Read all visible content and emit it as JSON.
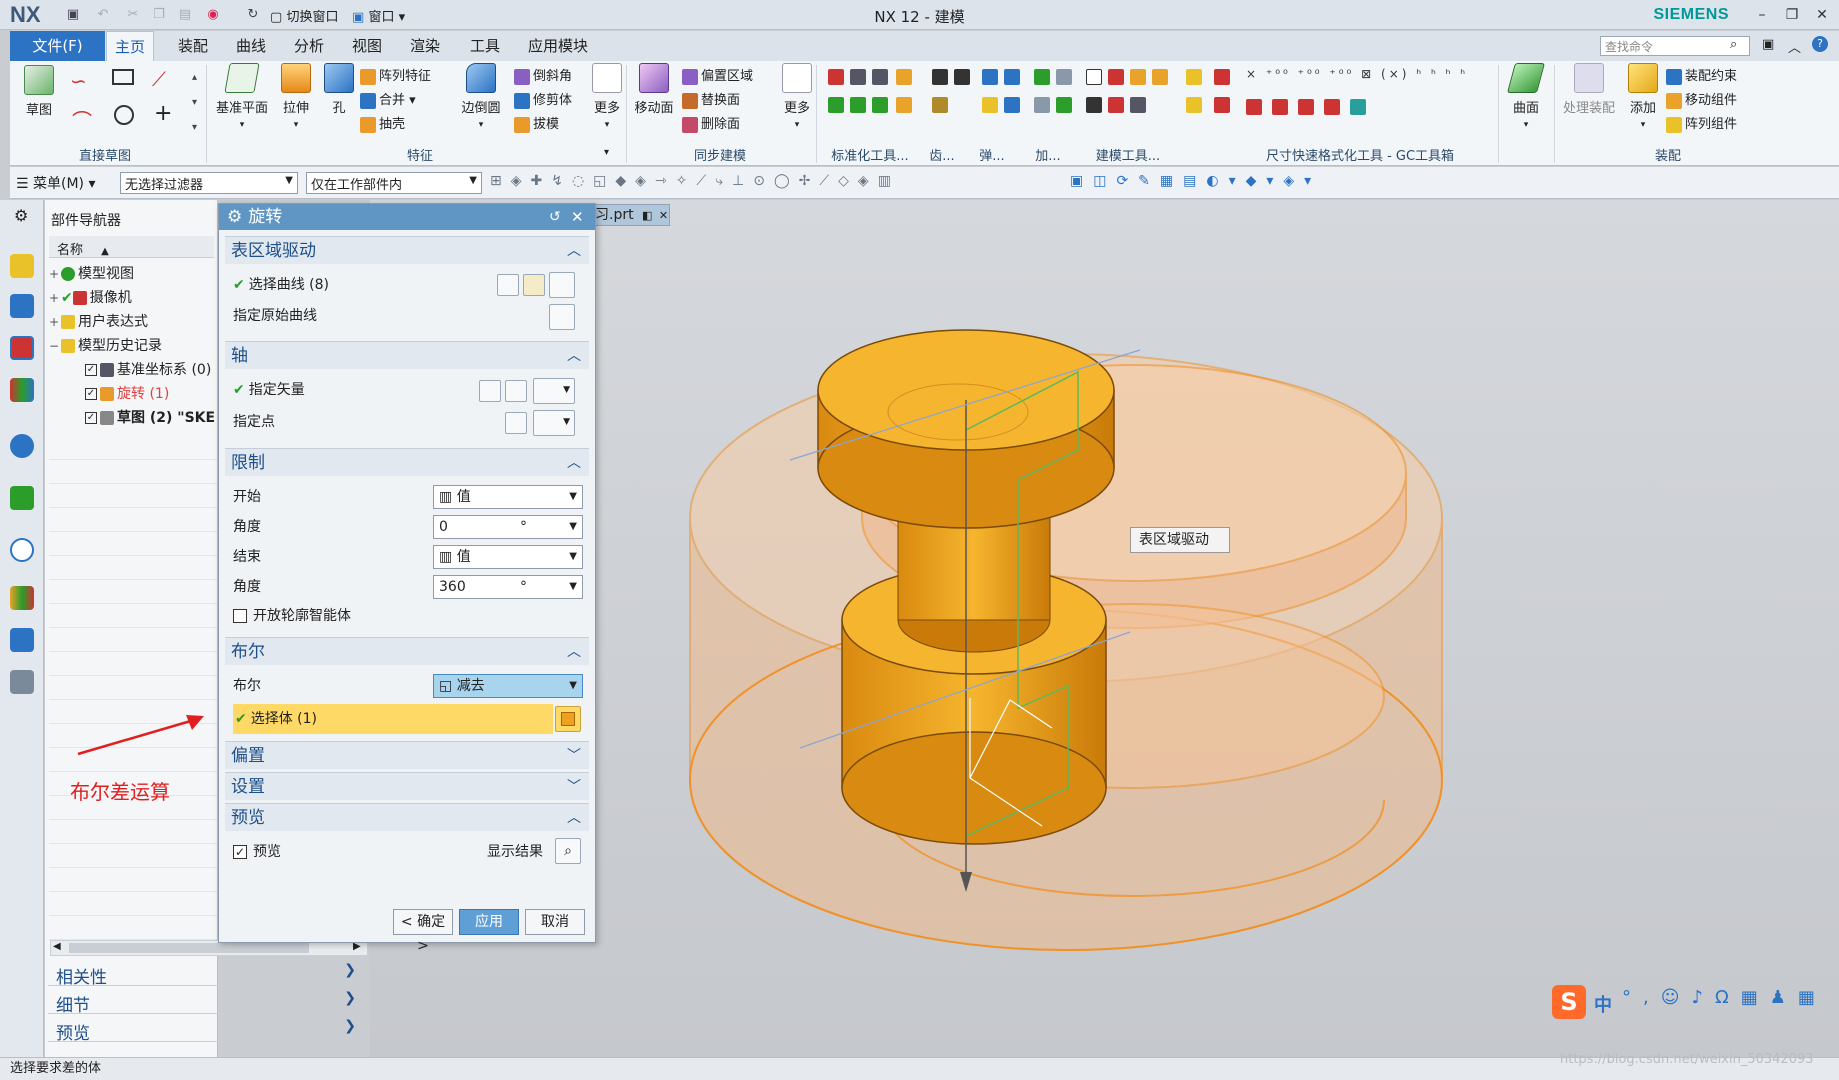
{
  "app": {
    "logo": "NX",
    "window_title": "NX 12 - 建模",
    "brand": "SIEMENS",
    "search_placeholder": "查找命令"
  },
  "menu_tabs": [
    "文件(F)",
    "主页",
    "装配",
    "曲线",
    "分析",
    "视图",
    "渲染",
    "工具",
    "应用模块"
  ],
  "quick_access": {
    "switch_window": "切换窗口",
    "window": "窗口"
  },
  "ribbon": {
    "sketch": {
      "label": "草图",
      "group": "直接草图"
    },
    "features": {
      "datum_plane": "基准平面",
      "extrude": "拉伸",
      "hole": "孔",
      "pattern_feature": "阵列特征",
      "unite": "合并",
      "shell": "抽壳",
      "edge_blend": "边倒圆",
      "chamfer": "倒斜角",
      "trim_body": "修剪体",
      "draft": "拔模",
      "more": "更多",
      "group": "特征"
    },
    "sync": {
      "move_face": "移动面",
      "offset_region": "偏置区域",
      "replace_face": "替换面",
      "delete_face": "删除面",
      "more": "更多",
      "group": "同步建模"
    },
    "small_groups": [
      "标准化工具...",
      "齿...",
      "弹...",
      "加...",
      "建模工具...",
      "尺寸快速格式化工具 - GC工具箱"
    ],
    "surface": {
      "label": "曲面"
    },
    "assembly": {
      "process_assembly": "处理装配",
      "add": "添加",
      "assembly_constraint": "装配约束",
      "move_component": "移动组件",
      "pattern_component": "阵列组件",
      "group": "装配"
    }
  },
  "toolbar2": {
    "menu": "菜单(M)",
    "filter": "无选择过滤器",
    "scope": "仅在工作部件内"
  },
  "navigator": {
    "title": "部件导航器",
    "column": "名称",
    "rows": [
      {
        "label": "模型视图",
        "exp": "+"
      },
      {
        "label": "摄像机",
        "exp": "+"
      },
      {
        "label": "用户表达式",
        "exp": "+"
      },
      {
        "label": "模型历史记录",
        "exp": "−"
      },
      {
        "label": "基准坐标系 (0)"
      },
      {
        "label": "旋转 (1)"
      },
      {
        "label": "草图 (2) \"SKE"
      }
    ],
    "panels": [
      "相关性",
      "细节",
      "预览"
    ]
  },
  "annotation": "布尔差运算",
  "dialog": {
    "title": "旋转",
    "sec_section": "表区域驱动",
    "select_curve": "选择曲线 (8)",
    "specify_origin_curve": "指定原始曲线",
    "sec_axis": "轴",
    "specify_vector": "指定矢量",
    "specify_point": "指定点",
    "sec_limits": "限制",
    "start": "开始",
    "start_value": "值",
    "angle": "角度",
    "start_angle": "0",
    "end": "结束",
    "end_value": "值",
    "end_angle": "360",
    "degree": "°",
    "open_profile": "开放轮廓智能体",
    "sec_boolean": "布尔",
    "boolean": "布尔",
    "boolean_value": "减去",
    "select_body": "选择体 (1)",
    "sec_offset": "偏置",
    "sec_settings": "设置",
    "sec_preview": "预览",
    "preview": "预览",
    "show_result": "显示结果",
    "ok": "< 确定 >",
    "apply": "应用",
    "cancel": "取消"
  },
  "file_tab": "习.prt",
  "tooltip": "表区域驱动",
  "status": "选择要求差的体",
  "watermark": "https://blog.csdn.net/weixin_50342093",
  "ime": {
    "lang": "中"
  },
  "colors": {
    "accent": "#2c73c4",
    "part_orange": "#f5a623",
    "highlight_row": "#ffd966",
    "annotation": "#e02020"
  }
}
